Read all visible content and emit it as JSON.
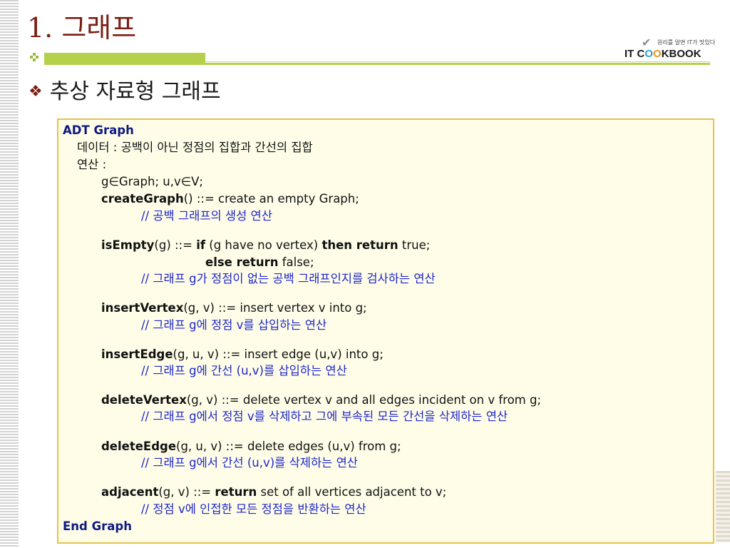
{
  "slide": {
    "title": "1. 그래프",
    "heading": "추상 자료형 그래프"
  },
  "logo": {
    "tagline": "원리를 알면 IT가 맛있다",
    "brand_prefix": "IT C",
    "brand_o1": "O",
    "brand_o2": "O",
    "brand_suffix": "KBOOK"
  },
  "adt": {
    "header": "ADT   Graph",
    "data_line": "데이터 : 공백이 아닌 정점의 집합과 간선의 집합",
    "ops_label": "연산 :",
    "decl": "g∈Graph; u,v∈V;",
    "create": {
      "name": "createGraph",
      "sig": "() ::= create an empty Graph;",
      "comment": "// 공백 그래프의 생성 연산"
    },
    "isEmpty": {
      "name": "isEmpty",
      "args": "(g) ::= ",
      "kw_if": "if",
      "cond": " (g have no vertex) ",
      "kw_then": "then return",
      "true_val": " true;",
      "kw_else": "else return",
      "false_val": " false;",
      "comment": "// 그래프 g가 정점이 없는 공백 그래프인지를 검사하는 연산"
    },
    "insertVertex": {
      "name": "insertVertex",
      "sig": "(g, v) ::= insert vertex v into g;",
      "comment": "// 그래프 g에 정점 v를 삽입하는 연산"
    },
    "insertEdge": {
      "name": "insertEdge",
      "sig": "(g, u, v) ::= insert edge (u,v) into g;",
      "comment": "// 그래프 g에 간선 (u,v)를 삽입하는 연산"
    },
    "deleteVertex": {
      "name": "deleteVertex",
      "sig": "(g, v) ::= delete vertex v and all edges incident on v from g;",
      "comment": "// 그래프 g에서 정점 v를 삭제하고 그에 부속된 모든 간선을 삭제하는 연산"
    },
    "deleteEdge": {
      "name": "deleteEdge",
      "sig": "(g, u, v) ::= delete edges (u,v) from   g;",
      "comment": "// 그래프 g에서 간선 (u,v)를 삭제하는 연산"
    },
    "adjacent": {
      "name": "adjacent",
      "args": "(g, v) ::= ",
      "kw_return": "return",
      "rest": " set of all vertices adjacent to v;",
      "comment": "// 정점 v에 인접한 모든 정점을 반환하는 연산"
    },
    "footer": "End Graph"
  },
  "colors": {
    "title": "#7a1e14",
    "accent_green": "#b5d14b",
    "box_border": "#e7c24a",
    "box_fill": "#fffde8",
    "navy": "#0f1a80",
    "comment_blue": "#1d27c8"
  }
}
